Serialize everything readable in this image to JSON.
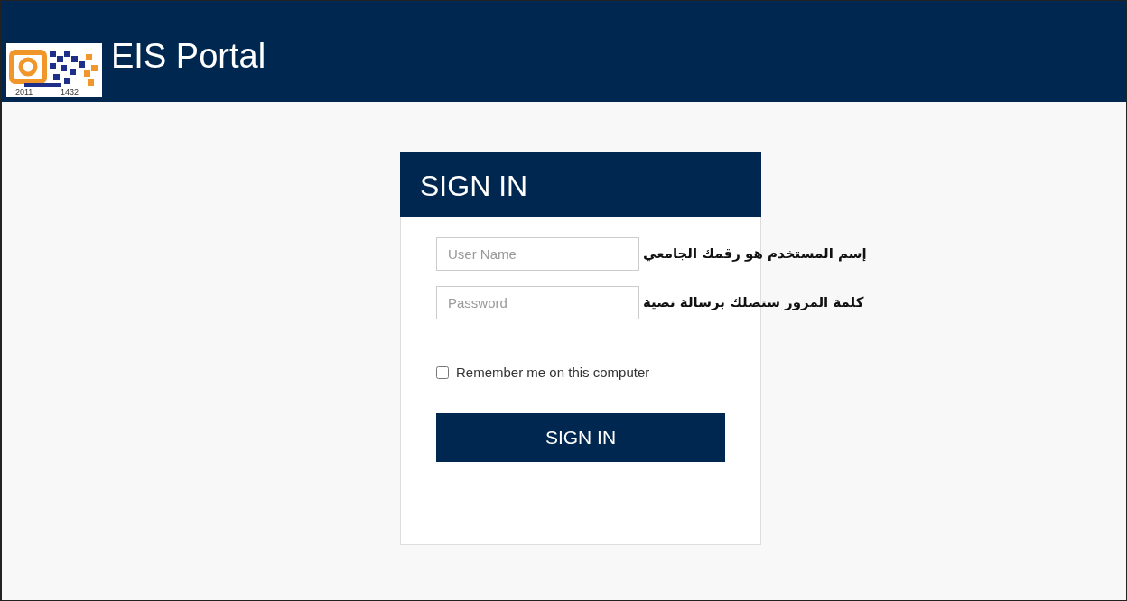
{
  "header": {
    "title": "EIS Portal",
    "logo_years": [
      "2011",
      "1432"
    ]
  },
  "login": {
    "title": "SIGN IN",
    "fields": [
      {
        "placeholder": "User Name",
        "hint": "إسم المستخدم هو رقمك الجامعي"
      },
      {
        "placeholder": "Password",
        "hint": "كلمة المرور ستصلك برسالة نصية"
      }
    ],
    "remember": {
      "label": "Remember me on this computer",
      "checked": false
    },
    "button": "SIGN IN"
  }
}
